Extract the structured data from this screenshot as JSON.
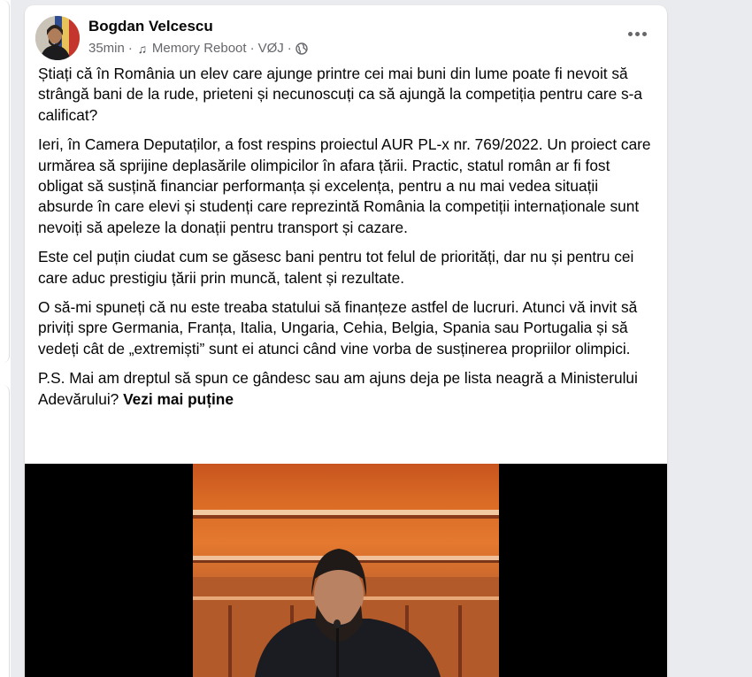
{
  "post": {
    "author": "Bogdan Velcescu",
    "time": "35min",
    "music_icon": "music-note-icon",
    "song": "Memory Reboot",
    "artist": "VØJ",
    "separator": "·",
    "privacy_icon": "globe-icon",
    "more_icon": "more-horizontal-icon",
    "paragraphs": [
      "Știați că în România un elev care ajunge printre cei mai buni din lume poate fi nevoit să strângă bani de la rude, prieteni și necunoscuți ca să ajungă la competiția pentru care s-a calificat?",
      "Ieri, în Camera Deputaților, a fost respins proiectul AUR PL-x nr. 769/2022. Un proiect care urmărea să sprijine deplasările olimpicilor în afara țării. Practic, statul român ar fi fost obligat să susțină financiar performanța și excelența, pentru a nu mai vedea situații absurde în care elevi și studenți care reprezintă România la competiții internaționale sunt nevoiți să apeleze la donații pentru transport și cazare.",
      "Este cel puțin ciudat cum se găsesc bani pentru tot felul de priorități, dar nu și pentru cei care aduc prestigiu țării prin muncă, talent și rezultate.",
      "O să-mi spuneți că nu este treaba statului să finanțeze astfel de lucruri. Atunci vă invit să priviți spre Germania, Franța, Italia, Ungaria, Cehia, Belgia, Spania sau Portugalia și să vedeți cât de „extremiști” sunt ei atunci când vine vorba de susținerea propriilor olimpici.",
      "P.S. Mai am dreptul să spun ce gândesc sau am ajuns deja pe lista neagră a Ministerului Adevărului?"
    ],
    "see_less": "Vezi mai puține"
  },
  "colors": {
    "background": "#e9ebee",
    "card": "#ffffff",
    "text": "#050505",
    "secondary_text": "#65676b"
  }
}
